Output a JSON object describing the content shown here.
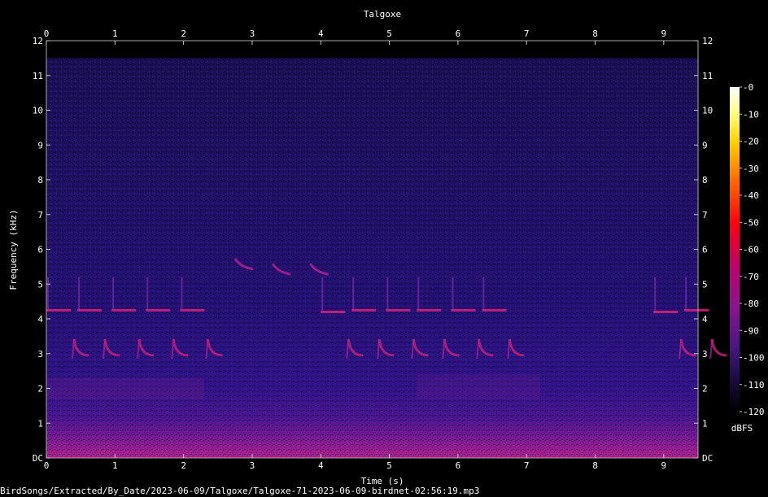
{
  "chart_data": {
    "type": "heatmap",
    "title": "Talgoxe",
    "xlabel": "Time (s)",
    "ylabel": "Frequency (kHz)",
    "xlim": [
      0,
      9.5
    ],
    "ylim": [
      0,
      12
    ],
    "x_ticks": [
      0,
      1,
      2,
      3,
      4,
      5,
      6,
      7,
      8,
      9
    ],
    "y_tick_labels": [
      "DC",
      "1",
      "2",
      "3",
      "4",
      "5",
      "6",
      "7",
      "8",
      "9",
      "10",
      "11",
      "12"
    ],
    "y_ticks": [
      0,
      1,
      2,
      3,
      4,
      5,
      6,
      7,
      8,
      9,
      10,
      11,
      12
    ],
    "signal_upper_khz": 11.5,
    "colorbar": {
      "label": "dBFS",
      "ticks": [
        "-0",
        "-10",
        "-20",
        "-30",
        "-40",
        "-50",
        "-60",
        "-70",
        "-80",
        "-90",
        "-100",
        "-110",
        "-120"
      ],
      "range": [
        -120,
        0
      ]
    },
    "song_phrases": [
      {
        "start_s": 0.0,
        "upper_khz": 4.25,
        "lower_khz": 2.95
      },
      {
        "start_s": 0.45,
        "upper_khz": 4.25,
        "lower_khz": 2.95
      },
      {
        "start_s": 0.95,
        "upper_khz": 4.25,
        "lower_khz": 2.95
      },
      {
        "start_s": 1.45,
        "upper_khz": 4.25,
        "lower_khz": 2.95
      },
      {
        "start_s": 1.95,
        "upper_khz": 4.25,
        "lower_khz": 2.95
      },
      {
        "start_s": 4.0,
        "upper_khz": 4.2,
        "lower_khz": 2.95
      },
      {
        "start_s": 4.45,
        "upper_khz": 4.25,
        "lower_khz": 2.95
      },
      {
        "start_s": 4.95,
        "upper_khz": 4.25,
        "lower_khz": 2.95
      },
      {
        "start_s": 5.4,
        "upper_khz": 4.25,
        "lower_khz": 2.95
      },
      {
        "start_s": 5.9,
        "upper_khz": 4.25,
        "lower_khz": 2.95
      },
      {
        "start_s": 6.35,
        "upper_khz": 4.25,
        "lower_khz": 2.95
      },
      {
        "start_s": 8.85,
        "upper_khz": 4.2,
        "lower_khz": 2.95
      },
      {
        "start_s": 9.3,
        "upper_khz": 4.25,
        "lower_khz": 2.95
      }
    ],
    "high_notes": [
      {
        "start_s": 2.75,
        "khz": 5.5
      },
      {
        "start_s": 3.3,
        "khz": 5.35
      },
      {
        "start_s": 3.85,
        "khz": 5.35
      }
    ]
  },
  "footer": {
    "file_path": "BirdSongs/Extracted/By_Date/2023-06-09/Talgoxe/Talgoxe-71-2023-06-09-birdnet-02:56:19.mp3"
  }
}
